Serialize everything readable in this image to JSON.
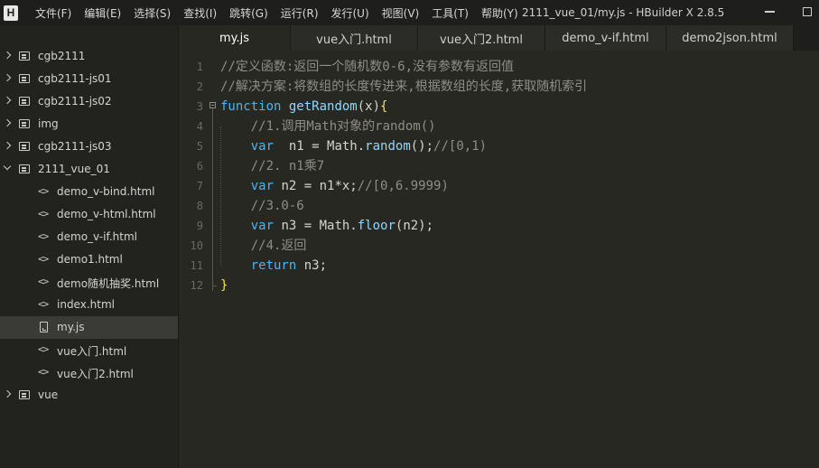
{
  "app": {
    "logo": "H",
    "window_title": "2111_vue_01/my.js - HBuilder X 2.8.5"
  },
  "menu": [
    "文件(F)",
    "编辑(E)",
    "选择(S)",
    "查找(I)",
    "跳转(G)",
    "运行(R)",
    "发行(U)",
    "视图(V)",
    "工具(T)",
    "帮助(Y)"
  ],
  "sidebar": {
    "items": [
      {
        "type": "folder",
        "label": "cgb2111",
        "open": false
      },
      {
        "type": "folder",
        "label": "cgb2111-js01",
        "open": false
      },
      {
        "type": "folder",
        "label": "cgb2111-js02",
        "open": false
      },
      {
        "type": "folder",
        "label": "img",
        "open": false
      },
      {
        "type": "folder",
        "label": "cgb2111-js03",
        "open": false
      },
      {
        "type": "folder",
        "label": "2111_vue_01",
        "open": true
      },
      {
        "type": "html",
        "label": "demo_v-bind.html",
        "icon": "<>"
      },
      {
        "type": "html",
        "label": "demo_v-html.html",
        "icon": "<>"
      },
      {
        "type": "html",
        "label": "demo_v-if.html",
        "icon": "<>"
      },
      {
        "type": "html",
        "label": "demo1.html",
        "icon": "<>"
      },
      {
        "type": "html",
        "label": "demo随机抽奖.html",
        "icon": "<>"
      },
      {
        "type": "html",
        "label": "index.html",
        "icon": "<>"
      },
      {
        "type": "js",
        "label": "my.js",
        "selected": true
      },
      {
        "type": "html",
        "label": "vue入门.html",
        "icon": "<>"
      },
      {
        "type": "html",
        "label": "vue入门2.html",
        "icon": "<>"
      },
      {
        "type": "folder",
        "label": "vue",
        "open": false
      }
    ]
  },
  "tabs": [
    {
      "label": "my.js",
      "active": true
    },
    {
      "label": "vue入门.html",
      "active": false
    },
    {
      "label": "vue入门2.html",
      "active": false
    },
    {
      "label": "demo_v-if.html",
      "active": false
    },
    {
      "label": "demo2json.html",
      "active": false
    }
  ],
  "editor": {
    "lines": [
      {
        "no": "1",
        "tokens": [
          {
            "t": "comment",
            "v": "//定义函数:返回一个随机数0-6,没有参数有返回值"
          }
        ]
      },
      {
        "no": "2",
        "tokens": [
          {
            "t": "comment",
            "v": "//解决方案:将数组的长度传进来,根据数组的长度,获取随机索引"
          }
        ]
      },
      {
        "no": "3",
        "tokens": [
          {
            "t": "keyword",
            "v": "function"
          },
          {
            "t": "plain",
            "v": " "
          },
          {
            "t": "func",
            "v": "getRandom"
          },
          {
            "t": "plain",
            "v": "(x)"
          },
          {
            "t": "brace",
            "v": "{"
          }
        ]
      },
      {
        "no": "4",
        "tokens": [
          {
            "t": "plain",
            "v": "    "
          },
          {
            "t": "comment",
            "v": "//1.调用Math对象的random()"
          }
        ]
      },
      {
        "no": "5",
        "tokens": [
          {
            "t": "plain",
            "v": "    "
          },
          {
            "t": "keyword",
            "v": "var"
          },
          {
            "t": "plain",
            "v": "  n1 = Math."
          },
          {
            "t": "func",
            "v": "random"
          },
          {
            "t": "plain",
            "v": "();"
          },
          {
            "t": "comment",
            "v": "//[0,1)"
          }
        ]
      },
      {
        "no": "6",
        "tokens": [
          {
            "t": "plain",
            "v": "    "
          },
          {
            "t": "comment",
            "v": "//2. n1乘7"
          }
        ]
      },
      {
        "no": "7",
        "tokens": [
          {
            "t": "plain",
            "v": "    "
          },
          {
            "t": "keyword",
            "v": "var"
          },
          {
            "t": "plain",
            "v": " n2 = n1*x;"
          },
          {
            "t": "comment",
            "v": "//[0,6.9999)"
          }
        ]
      },
      {
        "no": "8",
        "tokens": [
          {
            "t": "plain",
            "v": "    "
          },
          {
            "t": "comment",
            "v": "//3.0-6"
          }
        ]
      },
      {
        "no": "9",
        "tokens": [
          {
            "t": "plain",
            "v": "    "
          },
          {
            "t": "keyword",
            "v": "var"
          },
          {
            "t": "plain",
            "v": " n3 = Math."
          },
          {
            "t": "func",
            "v": "floor"
          },
          {
            "t": "plain",
            "v": "(n2);"
          }
        ]
      },
      {
        "no": "10",
        "tokens": [
          {
            "t": "plain",
            "v": "    "
          },
          {
            "t": "comment",
            "v": "//4.返回"
          }
        ]
      },
      {
        "no": "11",
        "tokens": [
          {
            "t": "plain",
            "v": "    "
          },
          {
            "t": "keyword",
            "v": "return"
          },
          {
            "t": "plain",
            "v": " n3;"
          }
        ]
      },
      {
        "no": "12",
        "tokens": [
          {
            "t": "brace",
            "v": "}"
          }
        ]
      }
    ]
  },
  "colors": {
    "background": "#272822",
    "sidebar": "#22231f",
    "keyword": "#4fb3f0",
    "function": "#8fd7ff",
    "comment": "#8e8e85"
  }
}
